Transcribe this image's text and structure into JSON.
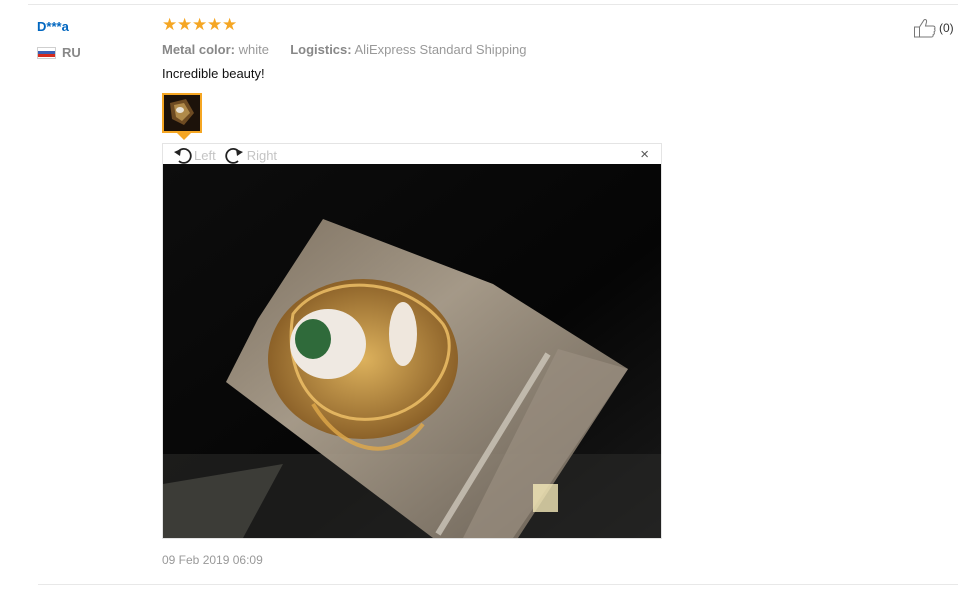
{
  "review": {
    "user_name": "D***a",
    "country": "RU",
    "rating": 5,
    "meta": {
      "metal_label": "Metal color:",
      "metal_value": "white",
      "logistics_label": "Logistics:",
      "logistics_value": "AliExpress Standard Shipping"
    },
    "text": "Incredible beauty!",
    "date": "09 Feb 2019 06:09",
    "helpful_count": "(0)"
  },
  "viewer": {
    "rotate_left_label": "Left",
    "rotate_right_label": "Right",
    "close_label": "×"
  },
  "icons": {
    "flag": "russia-flag-icon",
    "stars": "star-icon",
    "rotate_left": "rotate-left-icon",
    "rotate_right": "rotate-right-icon",
    "close": "close-icon",
    "thumbs_up": "thumbs-up-icon"
  },
  "colors": {
    "username": "#0066c0",
    "star": "#f5a623",
    "thumbnail_border": "#f5a623"
  }
}
